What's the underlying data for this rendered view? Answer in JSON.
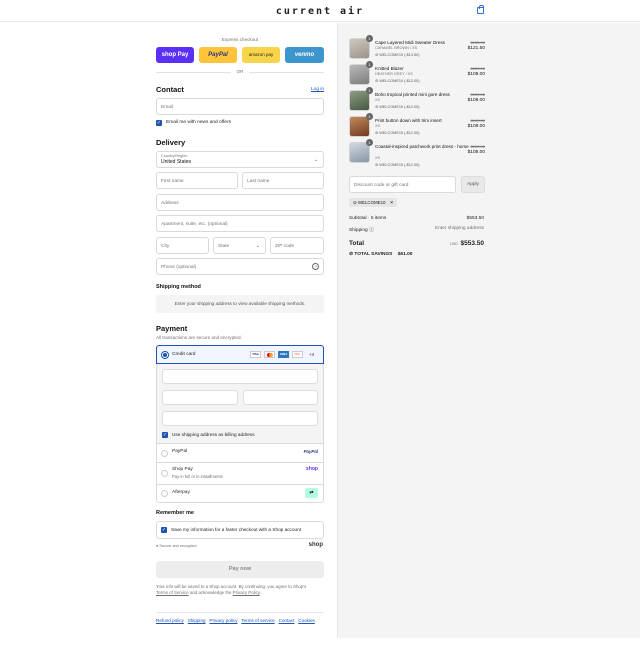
{
  "header": {
    "logo": "current air",
    "cart_icon": "shopping-bag-icon"
  },
  "express": {
    "title": "Express checkout",
    "buttons": [
      {
        "label": "shop Pay",
        "color": "#5a31f4"
      },
      {
        "label": "PayPal",
        "color": "#ffc439"
      },
      {
        "label": "amazon pay",
        "color": "#f7d44a"
      },
      {
        "label": "venmo",
        "color": "#3d95ce"
      }
    ],
    "or": "OR"
  },
  "contact": {
    "title": "Contact",
    "login": "Log in",
    "email_placeholder": "Email",
    "news_label": "Email me with news and offers"
  },
  "delivery": {
    "title": "Delivery",
    "country_label": "Country/Region",
    "country_value": "United States",
    "first_name": "First name",
    "last_name": "Last name",
    "address": "Address",
    "apartment": "Apartment, suite, etc. (optional)",
    "city": "City",
    "state": "State",
    "zip": "ZIP code",
    "phone": "Phone (optional)"
  },
  "shipping_method": {
    "title": "Shipping method",
    "notice": "Enter your shipping address to view available shipping methods."
  },
  "payment": {
    "title": "Payment",
    "subtitle": "All transactions are secure and encrypted.",
    "credit_card": "Credit card",
    "card_brands": [
      "VISA",
      "MC",
      "AMEX",
      "DISC"
    ],
    "more_brands": "+4",
    "billing_label": "Use shipping address as billing address",
    "paypal": "PayPal",
    "paypal_logo": "PayPal",
    "shop_pay": "Shop Pay",
    "shop_pay_sub": "Pay in full or in installments",
    "shop_logo": "shop",
    "afterpay": "Afterpay"
  },
  "remember": {
    "title": "Remember me",
    "save_label": "Save my information for a faster checkout with a Shop account",
    "secure": "Secure and encrypted",
    "shop_logo": "shop"
  },
  "pay_now": "Pay now",
  "legal": {
    "text": "Your info will be saved to a Shop account. By continuing, you agree to Shop's",
    "terms": "Terms of Service",
    "and": "and acknowledge the",
    "privacy": "Privacy Policy",
    "period": "."
  },
  "footer_links": [
    "Refund policy",
    "Shipping",
    "Privacy policy",
    "Terms of service",
    "Contact",
    "Cookies"
  ],
  "cart": {
    "items": [
      {
        "qty": "1",
        "name": "Cape Layered Midi Sweater Dress",
        "variant": "CARAMEL BROWN / XS",
        "discount": "WELCOME10 (-$13.50)",
        "old_price": "$135.00",
        "price": "$121.50"
      },
      {
        "qty": "1",
        "name": "Knitted Blazer",
        "variant": "HEATHER GREY / XS",
        "discount": "WELCOME10 (-$12.00)",
        "old_price": "$120.00",
        "price": "$108.00"
      },
      {
        "qty": "1",
        "name": "Boho tropical printed mini gore dress",
        "variant": "XS",
        "discount": "WELCOME10 (-$12.00)",
        "old_price": "$120.00",
        "price": "$108.00"
      },
      {
        "qty": "1",
        "name": "Print button down with trim insert",
        "variant": "XS",
        "discount": "WELCOME10 (-$12.00)",
        "old_price": "$120.00",
        "price": "$108.00"
      },
      {
        "qty": "1",
        "name": "Coastal-inspired patchwork print dress - home",
        "variant": "XS",
        "discount": "WELCOME10 (-$12.00)",
        "old_price": "$120.00",
        "price": "$108.00"
      }
    ],
    "discount_placeholder": "Discount code or gift card",
    "apply": "Apply",
    "applied_code": "WELCOME10",
    "subtotal_label": "Subtotal · 5 items",
    "subtotal": "$553.50",
    "shipping_label": "Shipping",
    "shipping_value": "Enter shipping address",
    "total_label": "Total",
    "currency": "USD",
    "total": "$553.50",
    "savings_label": "TOTAL SAVINGS",
    "savings": "$61.00"
  }
}
